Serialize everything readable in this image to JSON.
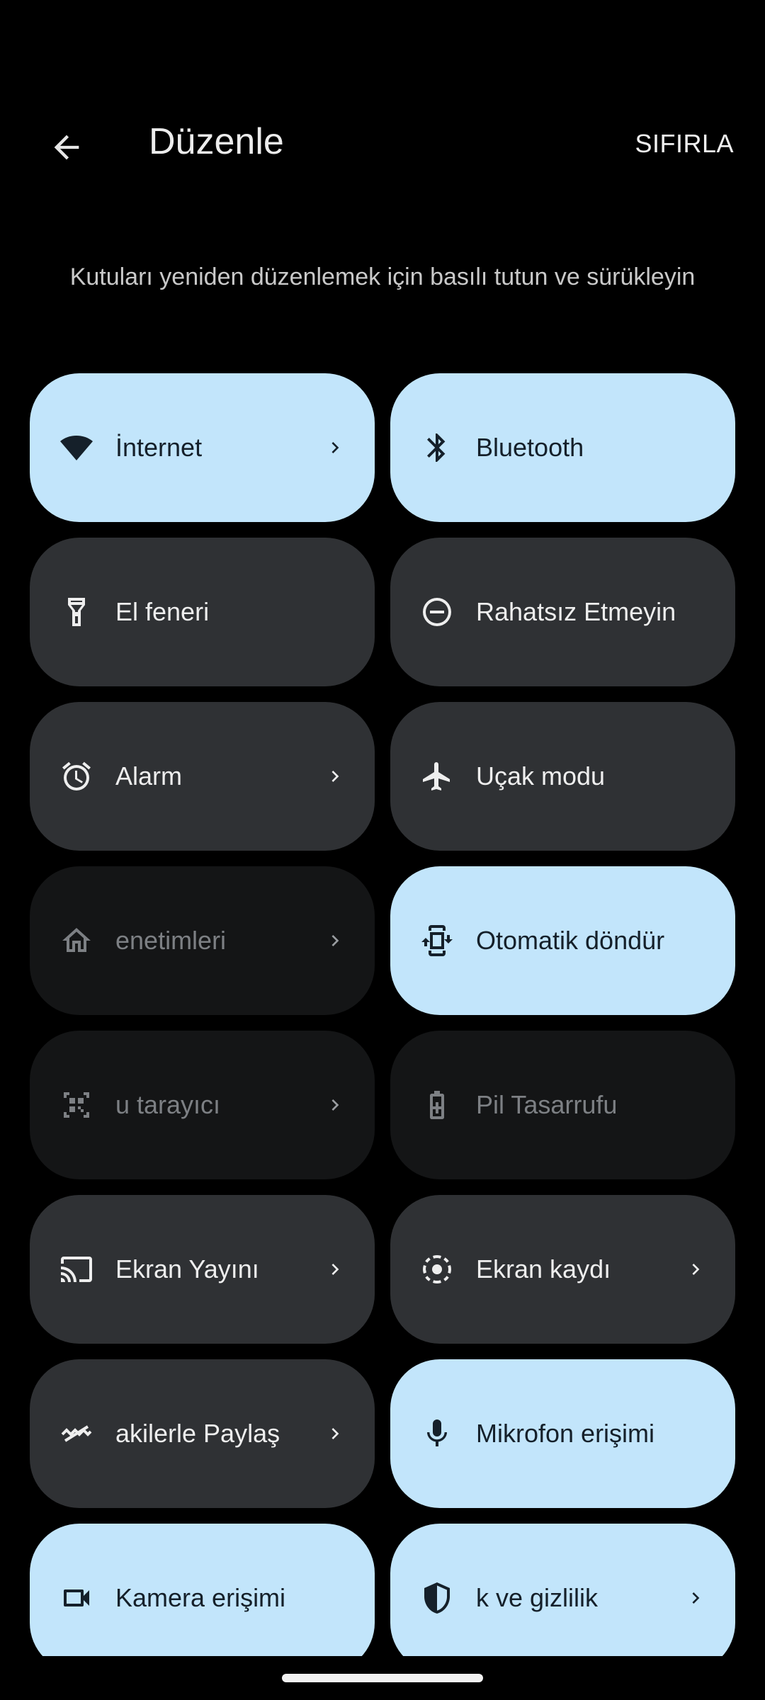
{
  "header": {
    "title": "Düzenle",
    "reset_label": "SIFIRLA"
  },
  "hint": "Kutuları yeniden düzenlemek için basılı tutun ve sürükleyin",
  "tiles": [
    {
      "label": "İnternet",
      "icon": "wifi-icon",
      "state": "on",
      "chevron": true
    },
    {
      "label": "Bluetooth",
      "icon": "bluetooth-icon",
      "state": "on",
      "chevron": false
    },
    {
      "label": "El feneri",
      "icon": "flashlight-icon",
      "state": "off",
      "chevron": false
    },
    {
      "label": "Rahatsız Etmeyin",
      "icon": "do-not-disturb-icon",
      "state": "off",
      "chevron": false
    },
    {
      "label": "Alarm",
      "icon": "alarm-icon",
      "state": "off",
      "chevron": true
    },
    {
      "label": "Uçak modu",
      "icon": "airplane-icon",
      "state": "off",
      "chevron": false
    },
    {
      "label": "enetimleri",
      "icon": "home-icon",
      "state": "dim",
      "chevron": true
    },
    {
      "label": "Otomatik döndür",
      "icon": "auto-rotate-icon",
      "state": "on",
      "chevron": false
    },
    {
      "label": "u tarayıcı",
      "icon": "qr-code-icon",
      "state": "dim",
      "chevron": true
    },
    {
      "label": "Pil Tasarrufu",
      "icon": "battery-saver-icon",
      "state": "dim",
      "chevron": false
    },
    {
      "label": "Ekran Yayını",
      "icon": "cast-icon",
      "state": "off",
      "chevron": true
    },
    {
      "label": "Ekran kaydı",
      "icon": "screen-record-icon",
      "state": "off",
      "chevron": true
    },
    {
      "label": "akilerle Paylaş",
      "icon": "nearby-share-icon",
      "state": "off",
      "chevron": true
    },
    {
      "label": "Mikrofon erişimi",
      "icon": "microphone-icon",
      "state": "on",
      "chevron": false
    },
    {
      "label": "Kamera erişimi",
      "icon": "camera-icon",
      "state": "on",
      "chevron": false
    },
    {
      "label": "k ve gizlilik",
      "icon": "shield-icon",
      "state": "on",
      "chevron": true
    }
  ],
  "colors": {
    "tile_on": "#c2e5fb",
    "tile_off": "#2f3134",
    "tile_dim": "#141516",
    "background": "#000000"
  }
}
